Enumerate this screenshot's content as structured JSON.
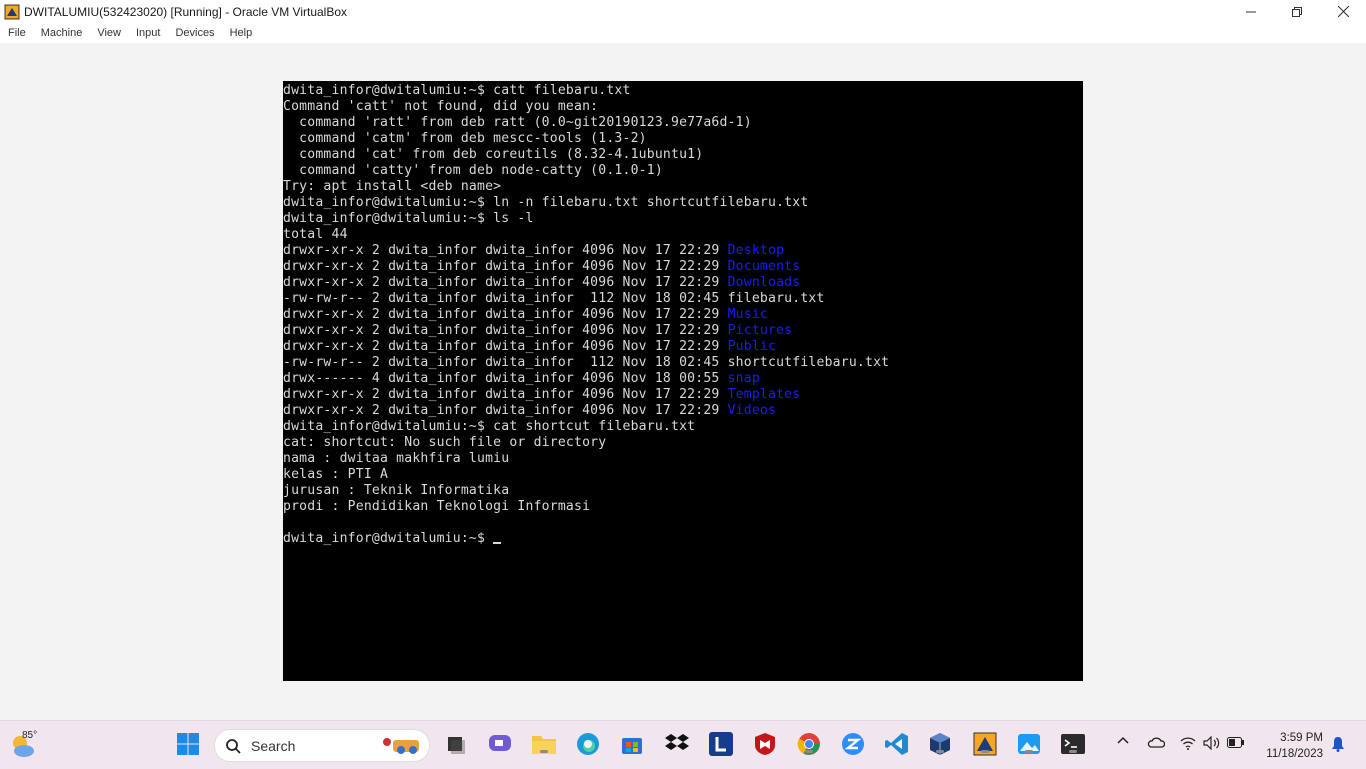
{
  "window": {
    "title": "DWITALUMIU(532423020) [Running] - Oracle VM VirtualBox",
    "menu": [
      "File",
      "Machine",
      "View",
      "Input",
      "Devices",
      "Help"
    ]
  },
  "terminal": {
    "lines": [
      [
        {
          "t": "dwita_infor@dwitalumiu:~$ catt filebaru.txt"
        }
      ],
      [
        {
          "t": "Command 'catt' not found, did you mean:"
        }
      ],
      [
        {
          "t": "  command 'ratt' from deb ratt (0.0~git20190123.9e77a6d-1)"
        }
      ],
      [
        {
          "t": "  command 'catm' from deb mescc-tools (1.3-2)"
        }
      ],
      [
        {
          "t": "  command 'cat' from deb coreutils (8.32-4.1ubuntu1)"
        }
      ],
      [
        {
          "t": "  command 'catty' from deb node-catty (0.1.0-1)"
        }
      ],
      [
        {
          "t": "Try: apt install <deb name>"
        }
      ],
      [
        {
          "t": "dwita_infor@dwitalumiu:~$ ln -n filebaru.txt shortcutfilebaru.txt"
        }
      ],
      [
        {
          "t": "dwita_infor@dwitalumiu:~$ ls -l"
        }
      ],
      [
        {
          "t": "total 44"
        }
      ],
      [
        {
          "t": "drwxr-xr-x 2 dwita_infor dwita_infor 4096 Nov 17 22:29 "
        },
        {
          "t": "Desktop",
          "c": "dir"
        }
      ],
      [
        {
          "t": "drwxr-xr-x 2 dwita_infor dwita_infor 4096 Nov 17 22:29 "
        },
        {
          "t": "Documents",
          "c": "dir"
        }
      ],
      [
        {
          "t": "drwxr-xr-x 2 dwita_infor dwita_infor 4096 Nov 17 22:29 "
        },
        {
          "t": "Downloads",
          "c": "dir"
        }
      ],
      [
        {
          "t": "-rw-rw-r-- 2 dwita_infor dwita_infor  112 Nov 18 02:45 filebaru.txt"
        }
      ],
      [
        {
          "t": "drwxr-xr-x 2 dwita_infor dwita_infor 4096 Nov 17 22:29 "
        },
        {
          "t": "Music",
          "c": "dir"
        }
      ],
      [
        {
          "t": "drwxr-xr-x 2 dwita_infor dwita_infor 4096 Nov 17 22:29 "
        },
        {
          "t": "Pictures",
          "c": "dir"
        }
      ],
      [
        {
          "t": "drwxr-xr-x 2 dwita_infor dwita_infor 4096 Nov 17 22:29 "
        },
        {
          "t": "Public",
          "c": "dir"
        }
      ],
      [
        {
          "t": "-rw-rw-r-- 2 dwita_infor dwita_infor  112 Nov 18 02:45 shortcutfilebaru.txt"
        }
      ],
      [
        {
          "t": "drwx------ 4 dwita_infor dwita_infor 4096 Nov 18 00:55 "
        },
        {
          "t": "snap",
          "c": "dir"
        }
      ],
      [
        {
          "t": "drwxr-xr-x 2 dwita_infor dwita_infor 4096 Nov 17 22:29 "
        },
        {
          "t": "Templates",
          "c": "dir"
        }
      ],
      [
        {
          "t": "drwxr-xr-x 2 dwita_infor dwita_infor 4096 Nov 17 22:29 "
        },
        {
          "t": "Videos",
          "c": "dir"
        }
      ],
      [
        {
          "t": "dwita_infor@dwitalumiu:~$ cat shortcut filebaru.txt"
        }
      ],
      [
        {
          "t": "cat: shortcut: No such file or directory"
        }
      ],
      [
        {
          "t": "nama : dwitaa makhfira lumiu"
        }
      ],
      [
        {
          "t": "kelas : PTI A"
        }
      ],
      [
        {
          "t": "jurusan : Teknik Informatika"
        }
      ],
      [
        {
          "t": "prodi : Pendidikan Teknologi Informasi"
        }
      ],
      [
        {
          "t": ""
        }
      ],
      [
        {
          "t": "dwita_infor@dwitalumiu:~$ "
        }
      ]
    ]
  },
  "taskbar": {
    "weather_temp": "85°",
    "search_label": "Search",
    "time": "3:59 PM",
    "date": "11/18/2023"
  },
  "colors": {
    "dir": "#1a1aff",
    "terminal_fg": "#d9d9d9",
    "terminal_bg": "#000000"
  }
}
